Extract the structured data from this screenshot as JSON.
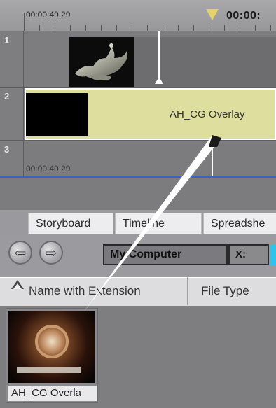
{
  "timeline": {
    "ruler_start_time": "00:00:49.29",
    "current_time": "00:00:",
    "tracks": [
      {
        "number": "1"
      },
      {
        "number": "2",
        "clip_label": "AH_CG Overlay"
      },
      {
        "number": "3",
        "timecode": "00:00:49.29"
      }
    ]
  },
  "tabs": [
    {
      "label": "Storyboard"
    },
    {
      "label": "Timeline"
    },
    {
      "label": "Spreadshe"
    }
  ],
  "browser": {
    "back_icon": "arrow-left-icon",
    "forward_icon": "arrow-right-icon",
    "path": "My Computer",
    "drive": "X:"
  },
  "columns": {
    "name": "Name with Extension",
    "type": "File Type"
  },
  "files": [
    {
      "label": "AH_CG Overla"
    }
  ],
  "colors": {
    "overlay_clip": "#dede9f",
    "playhead_marker": "#e6d26a",
    "accent_blue": "#3a5fd0",
    "drive_cyan": "#2ec3e8"
  }
}
